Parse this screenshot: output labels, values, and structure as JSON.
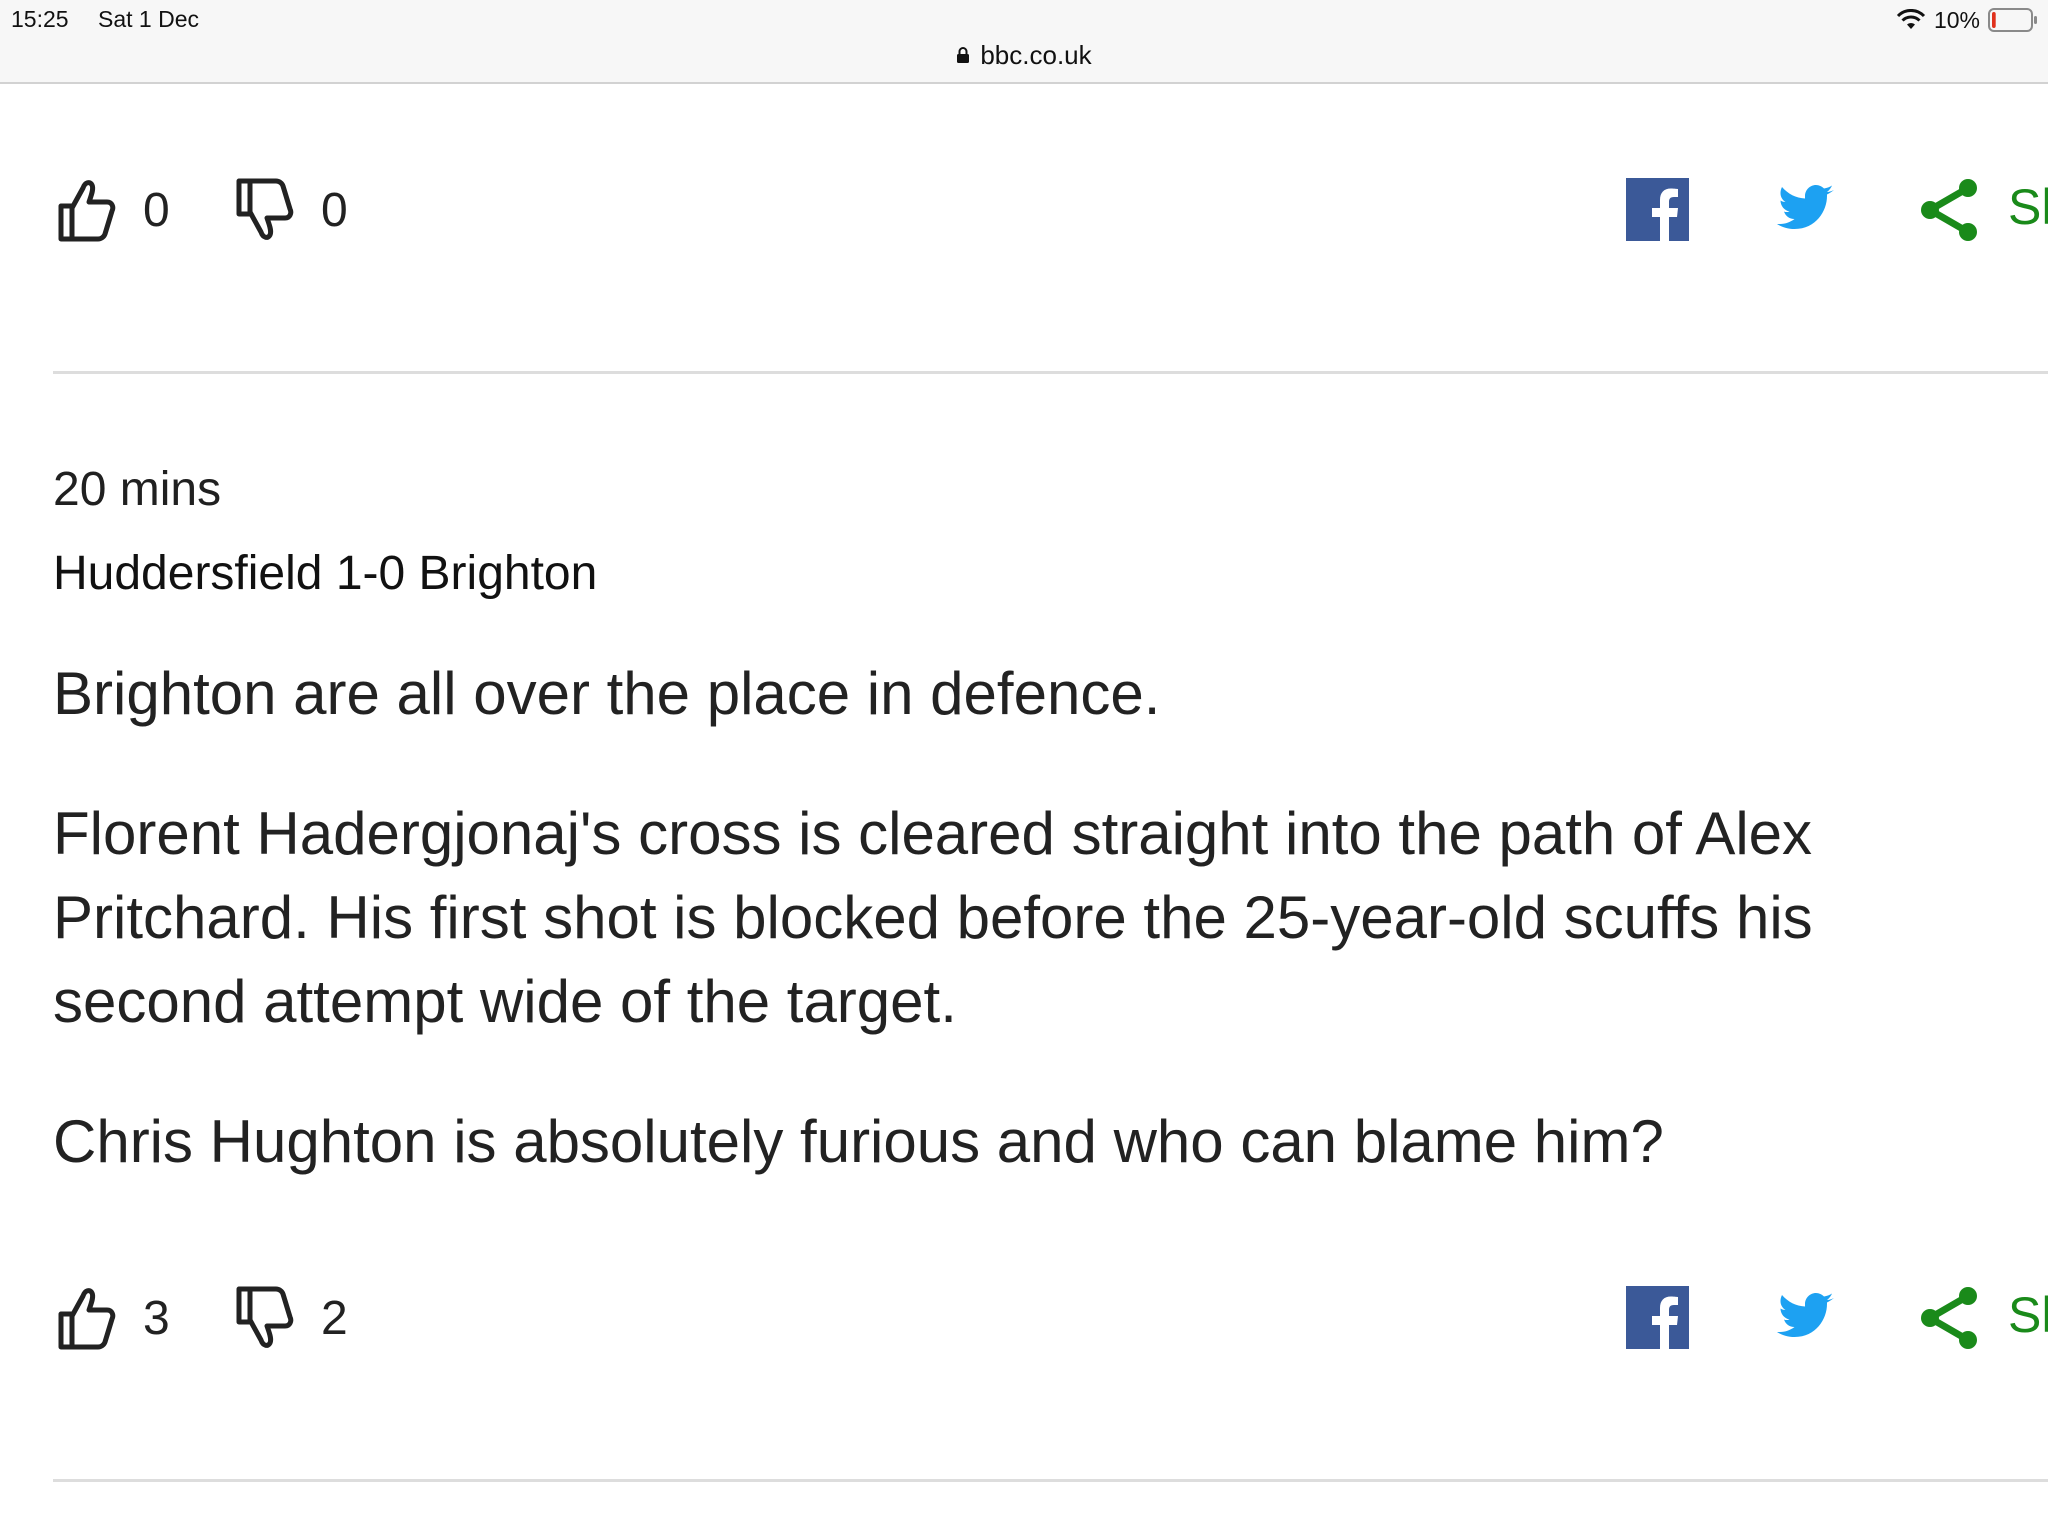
{
  "status_bar": {
    "time": "15:25",
    "date": "Sat 1 Dec",
    "battery_pct": "10%",
    "battery_level": 0.1,
    "wifi_icon": "wifi-icon",
    "battery_icon": "battery-icon"
  },
  "url_bar": {
    "url": "bbc.co.uk",
    "icon": "lock-icon"
  },
  "colors": {
    "facebook": "#3b5998",
    "twitter": "#1da1f2",
    "share_green": "#1a8a1a",
    "divider": "#dddddd"
  },
  "entries": [
    {
      "likes": "0",
      "dislikes": "0",
      "share_label": "Sh"
    },
    {
      "time": "20 mins",
      "title": "Huddersfield 1-0 Brighton",
      "paragraphs": [
        "Brighton are all over the place in defence.",
        "Florent Hadergjonaj's cross is cleared straight into the path of Alex Pritchard. His first shot is blocked before the 25-year-old scuffs his second attempt wide of the target.",
        "Chris Hughton is absolutely furious and who can blame him?"
      ],
      "likes": "3",
      "dislikes": "2",
      "share_label": "Sh"
    }
  ],
  "icons": {
    "like": "thumbs-up-icon",
    "dislike": "thumbs-down-icon",
    "facebook": "facebook-icon",
    "twitter": "twitter-icon",
    "share": "share-icon"
  }
}
